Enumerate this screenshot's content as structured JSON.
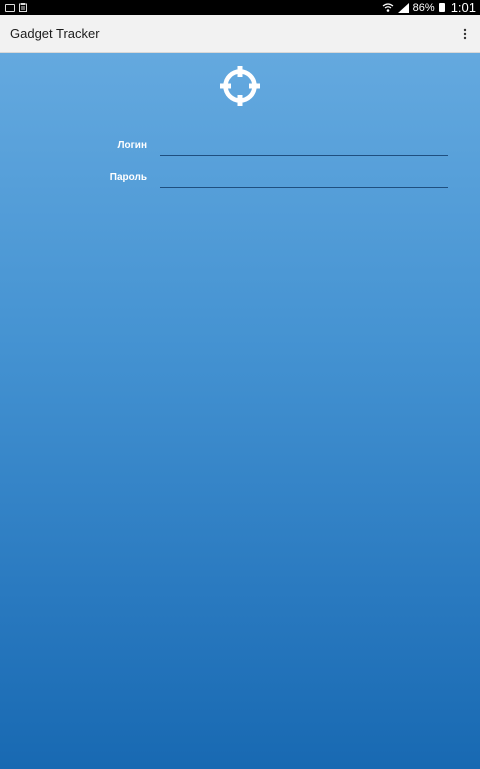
{
  "status_bar": {
    "battery": "86%",
    "time": "1:01",
    "icons": [
      "image-notification-icon",
      "clipboard-notification-icon",
      "wifi-icon",
      "signal-icon",
      "battery-icon"
    ]
  },
  "app_bar": {
    "title": "Gadget Tracker",
    "overflow_icon": "more-vert-icon"
  },
  "login_form": {
    "logo_icon": "crosshair-target-icon",
    "login_label": "Логин",
    "login_value": "",
    "password_label": "Пароль",
    "password_value": ""
  },
  "colors": {
    "gradient_top": "#64a9df",
    "gradient_bottom": "#1869b2",
    "app_bar": "#f2f2f2",
    "underline": "#1f4f7f"
  }
}
